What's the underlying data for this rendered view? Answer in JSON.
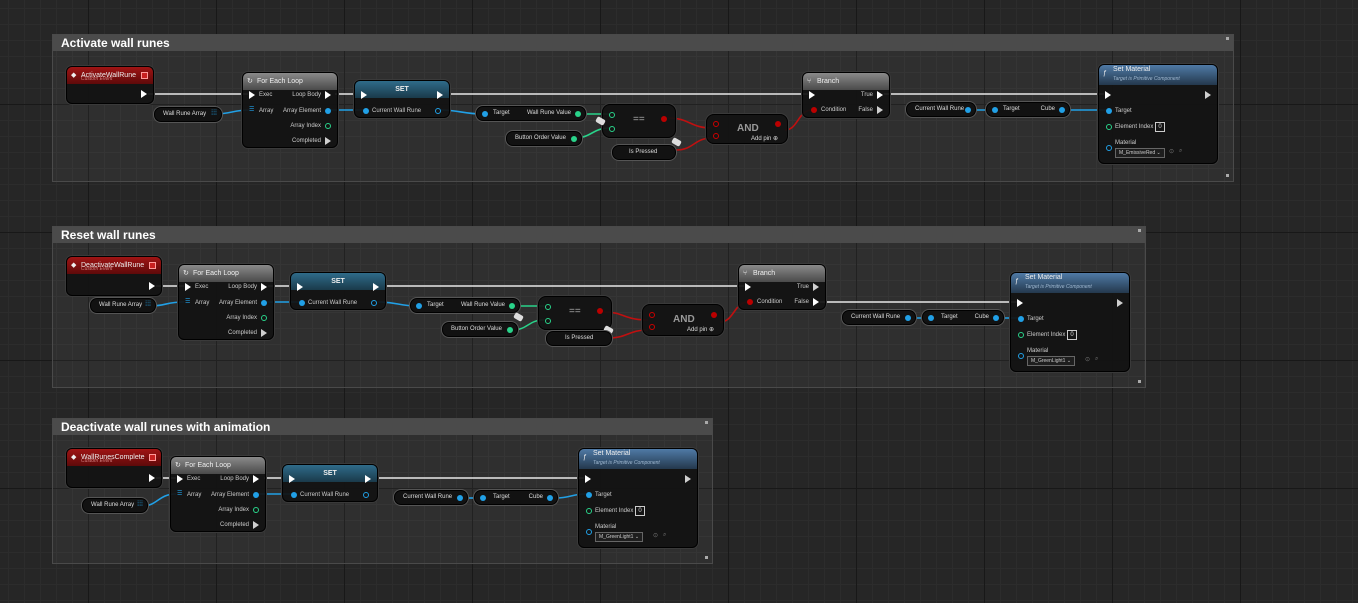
{
  "sections": [
    {
      "title": "Activate wall runes",
      "event": {
        "name": "ActivateWallRune",
        "subtitle": "Custom Event"
      },
      "array_var": "Wall Rune Array",
      "loop": {
        "title": "For Each Loop",
        "exec": "Exec",
        "array": "Array",
        "loop_body": "Loop Body",
        "array_element": "Array Element",
        "array_index": "Array Index",
        "completed": "Completed"
      },
      "set": {
        "title": "SET",
        "var": "Current Wall Rune"
      },
      "wall_rune_value": {
        "target": "Target",
        "value": "Wall Rune Value"
      },
      "button_order": "Button Order Value",
      "equals": "==",
      "is_pressed": "Is Pressed",
      "and_node": {
        "title": "AND",
        "add_pin": "Add pin"
      },
      "branch": {
        "title": "Branch",
        "condition": "Condition",
        "true": "True",
        "false": "False"
      },
      "current_wall_rune": "Current Wall Rune",
      "cube_getter": {
        "target": "Target",
        "value": "Cube"
      },
      "set_material": {
        "title": "Set Material",
        "subtitle": "Target is Primitive Component",
        "target": "Target",
        "element_index": "Element Index",
        "element_index_value": "0",
        "material": "Material",
        "material_value": "M_EmissiveRed"
      }
    },
    {
      "title": "Reset wall runes",
      "event": {
        "name": "DeactivateWallRune",
        "subtitle": "Custom Event"
      },
      "array_var": "Wall Rune Array",
      "loop": {
        "title": "For Each Loop",
        "exec": "Exec",
        "array": "Array",
        "loop_body": "Loop Body",
        "array_element": "Array Element",
        "array_index": "Array Index",
        "completed": "Completed"
      },
      "set": {
        "title": "SET",
        "var": "Current Wall Rune"
      },
      "wall_rune_value": {
        "target": "Target",
        "value": "Wall Rune Value"
      },
      "button_order": "Button Order Value",
      "equals": "==",
      "is_pressed": "Is Pressed",
      "and_node": {
        "title": "AND",
        "add_pin": "Add pin"
      },
      "branch": {
        "title": "Branch",
        "condition": "Condition",
        "true": "True",
        "false": "False"
      },
      "current_wall_rune": "Current Wall Rune",
      "cube_getter": {
        "target": "Target",
        "value": "Cube"
      },
      "set_material": {
        "title": "Set Material",
        "subtitle": "Target is Primitive Component",
        "target": "Target",
        "element_index": "Element Index",
        "element_index_value": "0",
        "material": "Material",
        "material_value": "M_GreenLight1"
      }
    },
    {
      "title": "Deactivate wall runes with animation",
      "event": {
        "name": "WallRunesComplete",
        "subtitle": "Custom Event"
      },
      "array_var": "Wall Rune Array",
      "loop": {
        "title": "For Each Loop",
        "exec": "Exec",
        "array": "Array",
        "loop_body": "Loop Body",
        "array_element": "Array Element",
        "array_index": "Array Index",
        "completed": "Completed"
      },
      "set": {
        "title": "SET",
        "var": "Current Wall Rune"
      },
      "current_wall_rune": "Current Wall Rune",
      "cube_getter": {
        "target": "Target",
        "value": "Cube"
      },
      "set_material": {
        "title": "Set Material",
        "subtitle": "Target is Primitive Component",
        "target": "Target",
        "element_index": "Element Index",
        "element_index_value": "0",
        "material": "Material",
        "material_value": "M_GreenLight1"
      }
    }
  ]
}
